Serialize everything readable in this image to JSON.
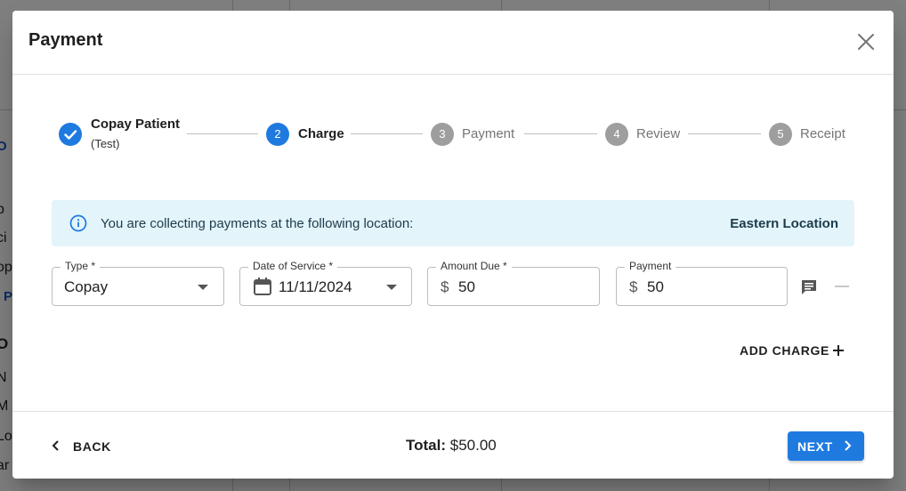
{
  "background": {
    "fragments": [
      "O",
      "p",
      "ci",
      "op",
      "P",
      "O",
      "N",
      "M -",
      "Lo",
      "ar"
    ]
  },
  "modal": {
    "title": "Payment"
  },
  "stepper": {
    "steps": [
      {
        "label": "Copay Patient",
        "sublabel": "(Test)",
        "status": "completed"
      },
      {
        "number": "2",
        "label": "Charge",
        "status": "active"
      },
      {
        "number": "3",
        "label": "Payment",
        "status": "pending"
      },
      {
        "number": "4",
        "label": "Review",
        "status": "pending"
      },
      {
        "number": "5",
        "label": "Receipt",
        "status": "pending"
      }
    ]
  },
  "banner": {
    "text": "You are collecting payments at the following location:",
    "location": "Eastern Location"
  },
  "charge_row": {
    "type": {
      "label": "Type *",
      "value": "Copay"
    },
    "date_of_service": {
      "label": "Date of Service *",
      "value": "11/11/2024"
    },
    "amount_due": {
      "label": "Amount Due *",
      "prefix": "$",
      "value": "50"
    },
    "payment": {
      "label": "Payment",
      "prefix": "$",
      "value": "50"
    }
  },
  "add_charge_label": "ADD CHARGE",
  "footer": {
    "back_label": "BACK",
    "total_label": "Total:",
    "total_value": "$50.00",
    "next_label": "NEXT"
  },
  "colors": {
    "primary": "#1f7ae0",
    "banner_bg": "#e3f4fb",
    "pending_step": "#9e9e9e"
  }
}
